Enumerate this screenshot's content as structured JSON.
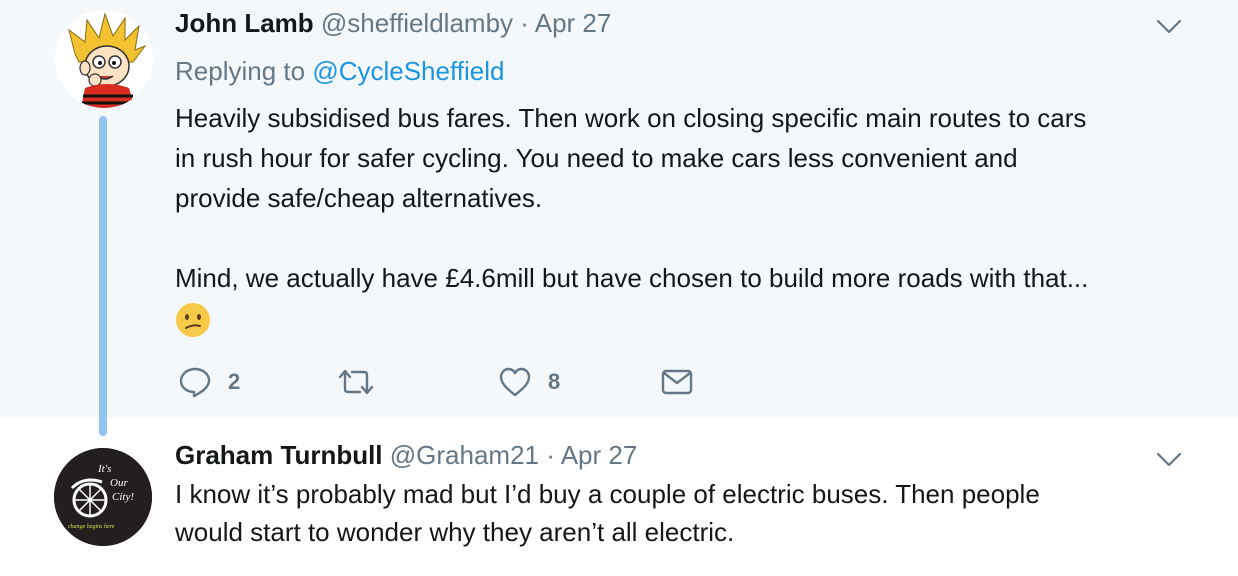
{
  "tweets": [
    {
      "author": {
        "name": "John Lamb",
        "handle": "@sheffieldlamby",
        "avatar": "calvin-cartoon-avatar"
      },
      "date": "Apr 27",
      "separator": "·",
      "replying_prefix": "Replying to",
      "replying_to": "@CycleSheffield",
      "lines": [
        "Heavily subsidised bus fares. Then work on closing specific main routes to cars",
        "in rush hour for safer cycling. You need to make cars less convenient and",
        "provide safe/cheap alternatives.",
        "Mind, we actually have £4.6mill but have chosen to build more roads with that..."
      ],
      "emoji": "confused-face-emoji",
      "actions": {
        "reply_count": "2",
        "retweet_count": "",
        "like_count": "8"
      }
    },
    {
      "author": {
        "name": "Graham Turnbull",
        "handle": "@Graham21",
        "avatar": "its-our-city-logo",
        "avatar_text": [
          "It's",
          "Our",
          "City!",
          "change begins here"
        ]
      },
      "date": "Apr 27",
      "separator": "·",
      "lines": [
        "I know it’s probably mad but I’d buy a couple of electric buses.  Then people",
        "would start to wonder why they aren’t all electric."
      ]
    }
  ],
  "colors": {
    "highlight_bg": "#f5f8fa",
    "thread_line": "#92c4f0",
    "link": "#1b95e0",
    "secondary_text": "#657786"
  }
}
